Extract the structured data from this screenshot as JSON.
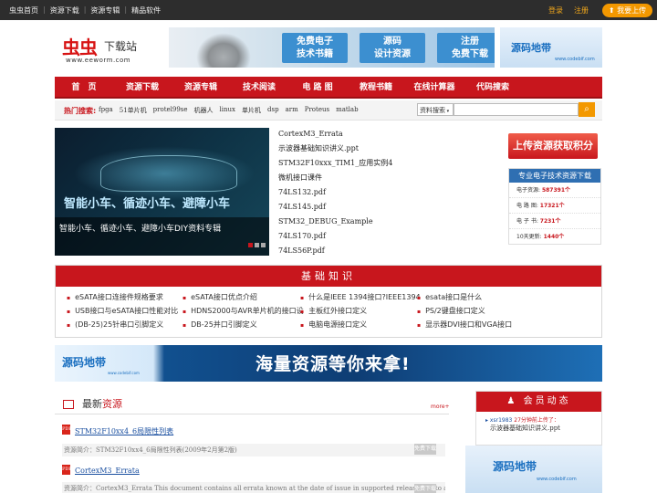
{
  "topbar": {
    "nav": [
      "虫虫首页",
      "资源下载",
      "资源专辑",
      "精品软件"
    ],
    "login": "登录",
    "register": "注册",
    "upload": "我要上传"
  },
  "header": {
    "logo_cn": "虫虫",
    "logo_suffix": "下载站",
    "logo_url": "www.eeworm.com",
    "banner_boxes": [
      {
        "line1": "免费电子",
        "line2": "技术书籍"
      },
      {
        "line1": "源码",
        "line2": "设计资源"
      },
      {
        "line1": "注册",
        "line2": "免费下载"
      }
    ],
    "ad_brand": "源码地带",
    "ad_url": "www.codebif.com"
  },
  "mainnav": [
    "首　页",
    "资源下载",
    "资源专辑",
    "技术阅读",
    "电 路 图",
    "教程书籍",
    "在线计算器",
    "代码搜索"
  ],
  "hot": {
    "label": "热门搜索:",
    "words": [
      "fpga",
      "51单片机",
      "protel99se",
      "机器人",
      "linux",
      "单片机",
      "dsp",
      "arm",
      "Proteus",
      "matlab"
    ],
    "select": "资料搜索"
  },
  "slider": {
    "big_text": "智能小车、循迹小车、避障小车",
    "caption": "智能小车、循迹小车、避障小车DIY资料专辑"
  },
  "files": [
    "CortexM3_Errata",
    "示波器基础知识讲义.ppt",
    "STM32F10xxx_TIM1_应用实例4",
    "微机接口课件",
    "74LS132.pdf",
    "74LS145.pdf",
    "STM32_DEBUG_Example",
    "74LS170.pdf",
    "74LS56P.pdf"
  ],
  "stats": {
    "upload_button": "上传资源获取积分",
    "title": "专业电子技术资源下载",
    "rows": [
      {
        "label": "电子资源:",
        "value": "587391个"
      },
      {
        "label": "电 路 图:",
        "value": "17321个"
      },
      {
        "label": "电 子 书:",
        "value": "7231个"
      },
      {
        "label": "10天更新:",
        "value": "1440个"
      }
    ]
  },
  "basic": {
    "title": "基础知识",
    "items": [
      "eSATA接口连接件规格要求",
      "eSATA接口优点介绍",
      "什么是IEEE 1394接口?IEEE1394",
      "esata接口是什么",
      "USB接口与eSATA接口性能对比",
      "HDNS2000与AVR单片机的接口设",
      "主板红外接口定义",
      "PS/2键盘接口定义",
      "(DB-25)25针串口引脚定义",
      "DB-25并口引脚定义",
      "电脑电源接口定义",
      "显示器DVI接口和VGA接口"
    ]
  },
  "midbanner": {
    "brand": "源码地带",
    "url": "www.codebif.com",
    "slogan": "海量资源等你来拿!"
  },
  "latest": {
    "title_prefix": "最新",
    "title_accent": "资源",
    "more": "more+",
    "entries": [
      {
        "title": "STM32F10xx4_6局限性列表",
        "desc": "资源简介：STM32F10xx4_6局限性列表(2009年2月第2版)",
        "dl": "免费下载"
      },
      {
        "title": "CortexM3_Errata",
        "desc": "资源简介：CortexM3_Errata This document contains all errata known at the date of issue in supported releases up to and includi...",
        "dl": "免费下载"
      }
    ]
  },
  "member": {
    "title": "会员动态",
    "user": "xsr1983",
    "action": "27分钟前上传了：",
    "file": "示波器基础知识讲义.ppt"
  },
  "colors": {
    "brand_red": "#c8161d",
    "accent_orange": "#f39800",
    "link_blue": "#1a4fa0"
  }
}
